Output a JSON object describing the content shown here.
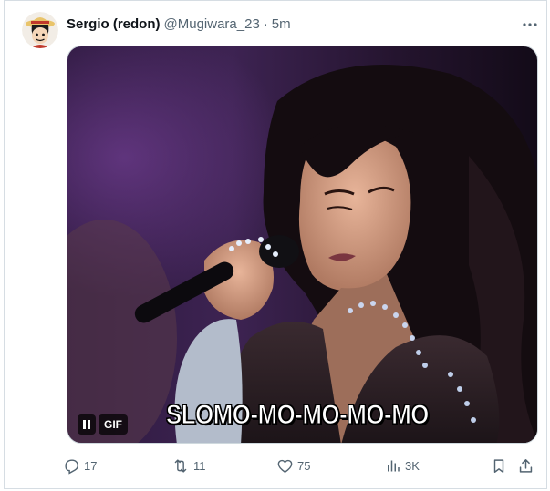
{
  "tweet": {
    "display_name": "Sergio (redon)",
    "handle": "@Mugiwara_23",
    "separator": "·",
    "time": "5m",
    "more_icon": "more-horizontal-icon",
    "avatar_icon": "straw-hat-avatar"
  },
  "media": {
    "caption": "SLOMO-MO-MO-MO-MO",
    "gif_badge": "GIF",
    "pause_icon": "pause-icon"
  },
  "actions": {
    "reply": {
      "icon": "reply-icon",
      "count": "17"
    },
    "retweet": {
      "icon": "retweet-icon",
      "count": "11"
    },
    "like": {
      "icon": "heart-icon",
      "count": "75"
    },
    "views": {
      "icon": "analytics-icon",
      "count": "3K"
    },
    "bookmark": {
      "icon": "bookmark-icon"
    },
    "share": {
      "icon": "share-icon"
    }
  },
  "colors": {
    "text_primary": "#0f1419",
    "text_secondary": "#536471",
    "border": "#cfd9de",
    "stage_purple": "#3a1f4a"
  }
}
